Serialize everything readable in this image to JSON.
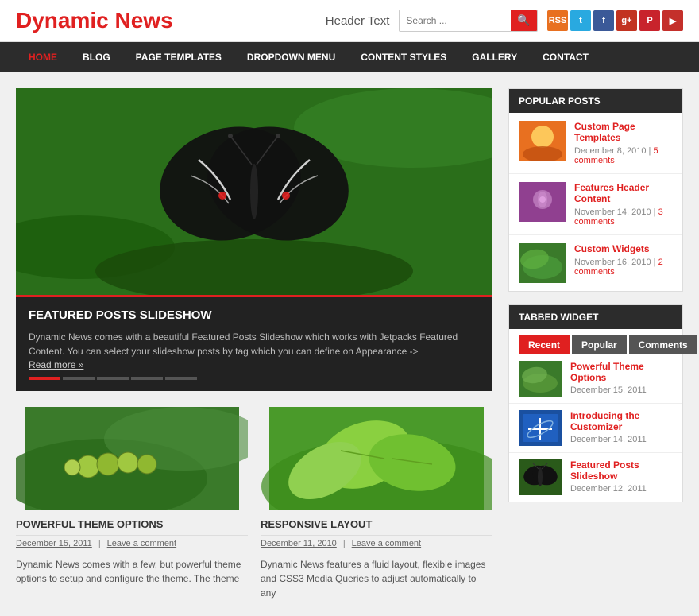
{
  "header": {
    "site_title": "Dynamic News",
    "header_text": "Header Text",
    "search_placeholder": "Search ...",
    "social_icons": [
      {
        "name": "rss-icon",
        "label": "RSS",
        "color": "#e87020"
      },
      {
        "name": "twitter-icon",
        "label": "t",
        "color": "#29a9e0"
      },
      {
        "name": "facebook-icon",
        "label": "f",
        "color": "#3b5998"
      },
      {
        "name": "google-plus-icon",
        "label": "g+",
        "color": "#c23321"
      },
      {
        "name": "pinterest-icon",
        "label": "p",
        "color": "#c8232c"
      },
      {
        "name": "youtube-icon",
        "label": "▶",
        "color": "#c4302b"
      }
    ]
  },
  "nav": {
    "items": [
      {
        "label": "HOME",
        "active": true
      },
      {
        "label": "BLOG",
        "active": false
      },
      {
        "label": "PAGE TEMPLATES",
        "active": false
      },
      {
        "label": "DROPDOWN MENU",
        "active": false
      },
      {
        "label": "CONTENT STYLES",
        "active": false
      },
      {
        "label": "GALLERY",
        "active": false
      },
      {
        "label": "CONTACT",
        "active": false
      }
    ]
  },
  "slideshow": {
    "title": "FEATURED POSTS SLIDESHOW",
    "description": "Dynamic News comes with a beautiful Featured Posts Slideshow which works with Jetpacks Featured Content. You can select your slideshow posts by tag which you can define on Appearance ->",
    "read_more": "Read more »",
    "dots": 5
  },
  "posts": [
    {
      "id": "post-1",
      "title": "POWERFUL THEME OPTIONS",
      "date": "December 15, 2011",
      "comment": "Leave a comment",
      "excerpt": "Dynamic News comes with a few, but powerful theme options to setup and configure the theme. The theme"
    },
    {
      "id": "post-2",
      "title": "RESPONSIVE LAYOUT",
      "date": "December 11, 2010",
      "comment": "Leave a comment",
      "excerpt": "Dynamic News features a fluid layout, flexible images and CSS3 Media Queries to adjust automatically to any"
    }
  ],
  "sidebar": {
    "popular_posts": {
      "title": "POPULAR POSTS",
      "items": [
        {
          "title": "Custom Page Templates",
          "date": "December 8, 2010",
          "comments": "5 comments",
          "thumb_type": "orange"
        },
        {
          "title": "Features Header Content",
          "date": "November 14, 2010",
          "comments": "3 comments",
          "thumb_type": "purple"
        },
        {
          "title": "Custom Widgets",
          "date": "November 16, 2010",
          "comments": "2 comments",
          "thumb_type": "green"
        }
      ]
    },
    "tabbed_widget": {
      "title": "TABBED WIDGET",
      "tabs": [
        "Recent",
        "Popular",
        "Comments"
      ],
      "active_tab": 0,
      "posts": [
        {
          "title": "Powerful Theme Options",
          "date": "December 15, 2011",
          "thumb_type": "green"
        },
        {
          "title": "Introducing the Customizer",
          "date": "December 14, 2011",
          "thumb_type": "blue"
        },
        {
          "title": "Featured Posts Slideshow",
          "date": "December 12, 2011",
          "thumb_type": "butterfly"
        }
      ]
    }
  }
}
